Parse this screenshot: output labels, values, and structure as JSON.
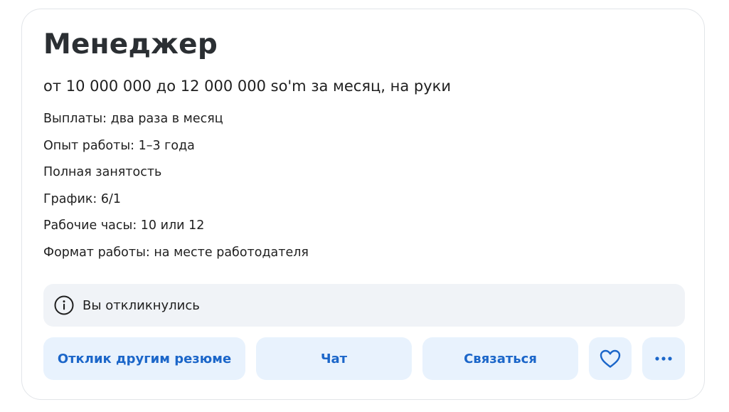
{
  "vacancy": {
    "title": "Менеджер",
    "salary": "от 10 000 000 до 12 000 000 so'm за месяц, на руки",
    "details": [
      "Выплаты: два раза в месяц",
      "Опыт работы: 1–3 года",
      "Полная занятость",
      "График: 6/1",
      "Рабочие часы: 10 или 12",
      "Формат работы: на месте работодателя"
    ]
  },
  "notice": {
    "icon": "info-icon",
    "text": "Вы откликнулись"
  },
  "actions": {
    "respond_other_resume": "Отклик другим резюме",
    "chat": "Чат",
    "contact": "Связаться",
    "favorite_icon": "heart-icon",
    "more_icon": "more-dots-icon"
  },
  "colors": {
    "accent": "#1b66c9",
    "button_bg": "#e8f2fd",
    "notice_bg": "#f0f3f7",
    "card_border": "#e2e5e9"
  }
}
